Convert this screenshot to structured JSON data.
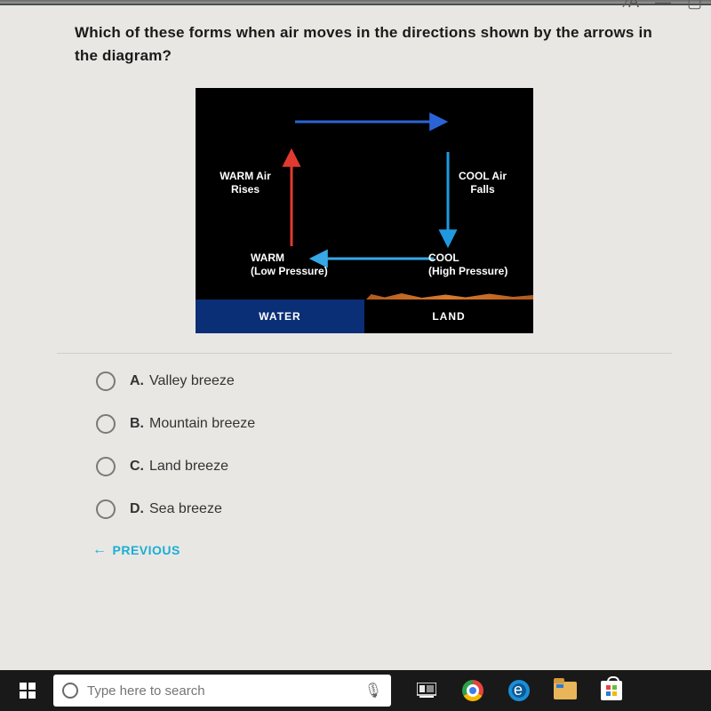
{
  "question": "Which of these forms when air moves in the directions shown by the arrows in the diagram?",
  "diagram": {
    "warm_air": "WARM Air\nRises",
    "cool_air": "COOL Air\nFalls",
    "warm_low": "WARM\n(Low Pressure)",
    "cool_high": "COOL\n(High Pressure)",
    "water": "WATER",
    "land": "LAND"
  },
  "options": {
    "a": {
      "letter": "A.",
      "text": "Valley breeze"
    },
    "b": {
      "letter": "B.",
      "text": "Mountain breeze"
    },
    "c": {
      "letter": "C.",
      "text": "Land breeze"
    },
    "d": {
      "letter": "D.",
      "text": "Sea breeze"
    }
  },
  "nav": {
    "previous": "PREVIOUS"
  },
  "taskbar": {
    "search_placeholder": "Type here to search"
  }
}
